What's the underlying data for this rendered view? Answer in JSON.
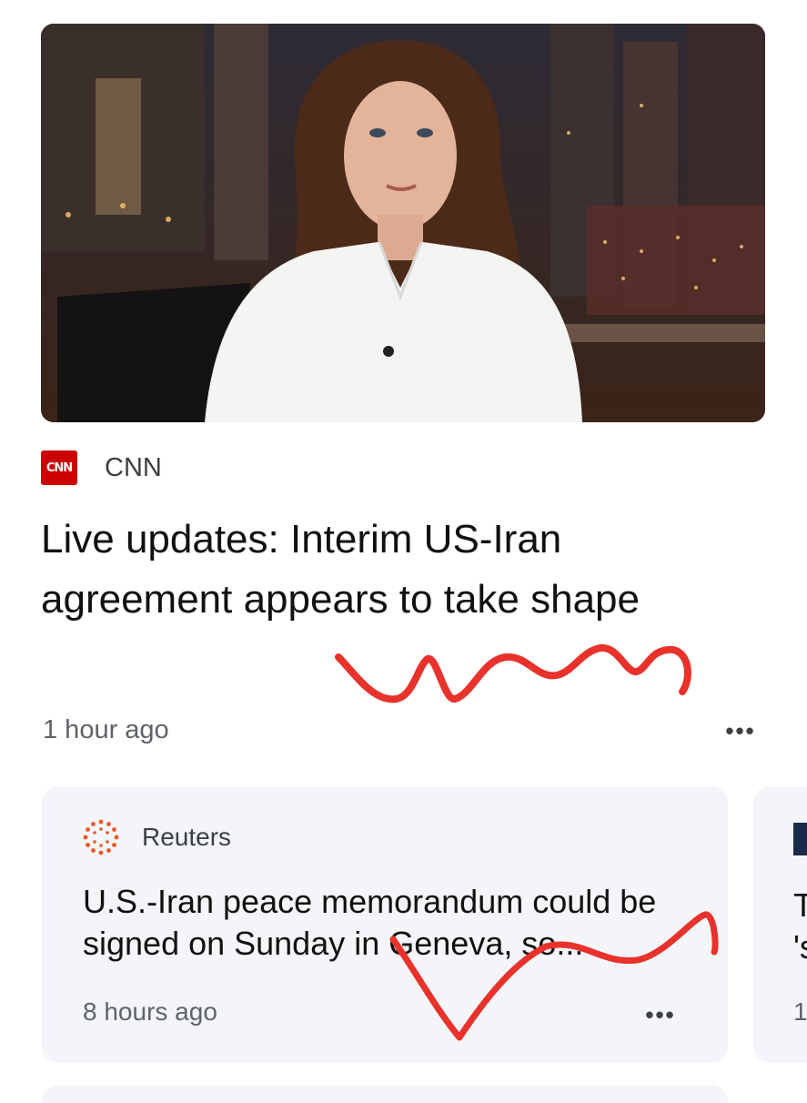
{
  "main_story": {
    "source": {
      "name": "CNN",
      "logo_text": "CNN",
      "logo_color": "#cc0000"
    },
    "headline": "Live updates: Interim US-Iran agreement appears to take shape",
    "time": "1 hour ago",
    "more_label": "•••"
  },
  "secondary_cards": [
    {
      "source": {
        "name": "Reuters",
        "logo_icon": "reuters-dots-icon",
        "logo_color": "#e8572a"
      },
      "title": "U.S.-Iran peace memorandum could be signed on Sunday in Geneva, so...",
      "time": "8 hours ago",
      "more_label": "•••"
    },
    {
      "partial_title_lines": [
        "T",
        "'s"
      ],
      "partial_time": "1"
    }
  ],
  "annotations": {
    "scribble_color": "#e8322b"
  }
}
